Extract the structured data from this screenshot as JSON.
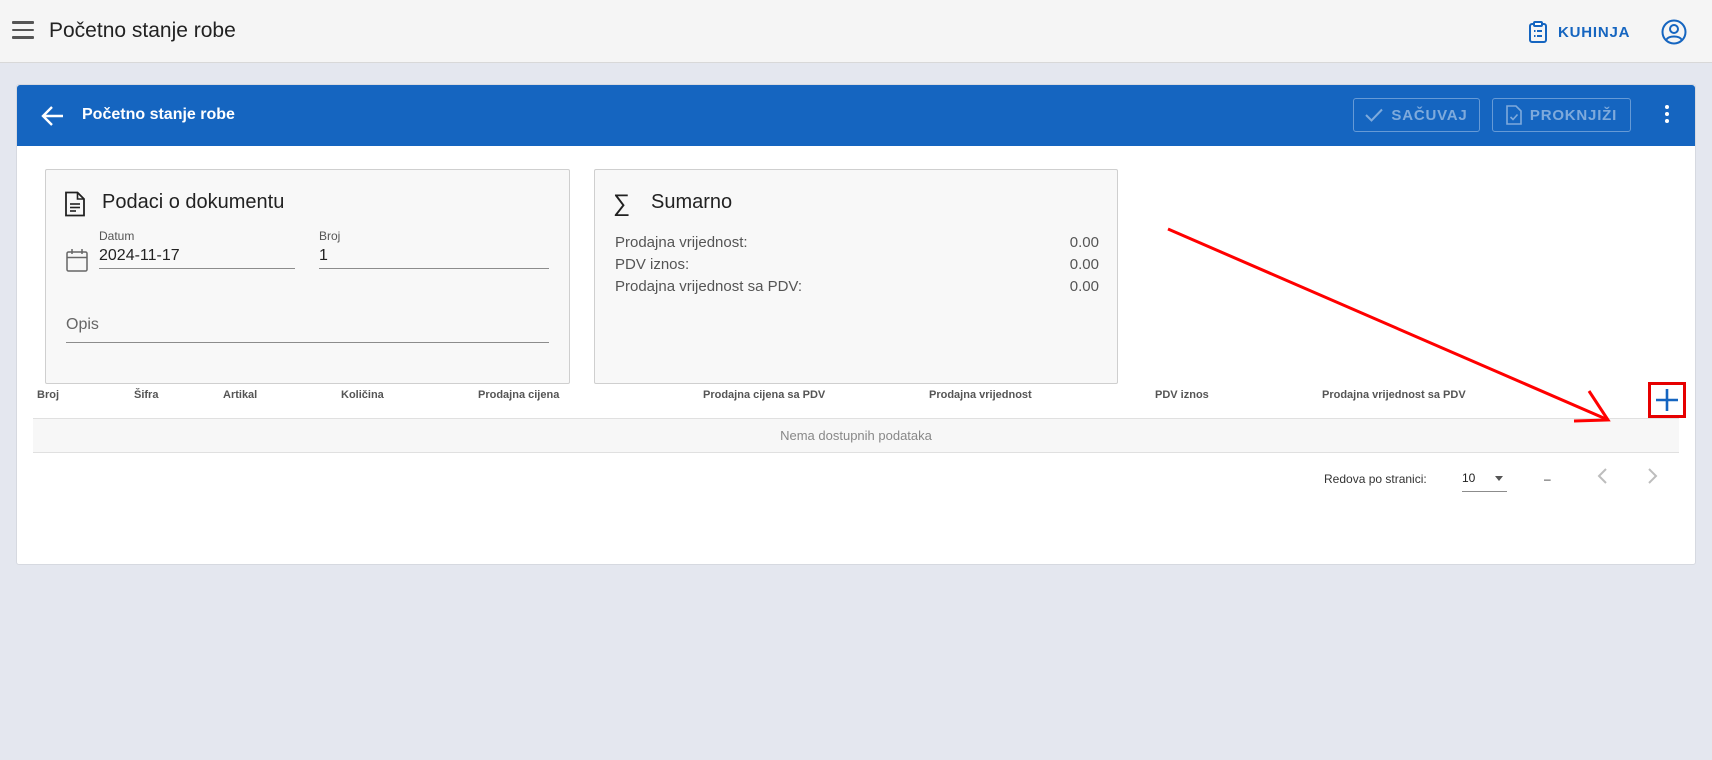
{
  "appbar": {
    "title": "Početno stanje robe",
    "location_label": "KUHINJA"
  },
  "card": {
    "title": "Početno stanje robe",
    "save_label": "SAČUVAJ",
    "post_label": "PROKNJIŽI"
  },
  "document_panel": {
    "title": "Podaci o dokumentu",
    "date_label": "Datum",
    "date_value": "2024-11-17",
    "number_label": "Broj",
    "number_value": "1",
    "description_label": "Opis"
  },
  "summary_panel": {
    "title": "Sumarno",
    "rows": [
      {
        "label": "Prodajna vrijednost:",
        "value": "0.00"
      },
      {
        "label": "PDV iznos:",
        "value": "0.00"
      },
      {
        "label": "Prodajna vrijednost sa PDV:",
        "value": "0.00"
      }
    ]
  },
  "table": {
    "columns": [
      "Broj",
      "Šifra",
      "Artikal",
      "Količina",
      "Prodajna cijena",
      "Prodajna cijena sa PDV",
      "Prodajna vrijednost",
      "PDV iznos",
      "Prodajna vrijednost sa PDV"
    ],
    "empty_text": "Nema dostupnih podataka"
  },
  "pagination": {
    "rows_per_page_label": "Redova po stranici:",
    "rows_per_page_value": "10",
    "range_text": "–"
  },
  "colors": {
    "primary": "#1565c0",
    "highlight": "#e60000"
  },
  "icons": [
    "menu-icon",
    "clipboard-icon",
    "account-icon",
    "arrow-left-icon",
    "check-icon",
    "document-check-icon",
    "more-vert-icon",
    "document-icon",
    "calendar-icon",
    "sigma-icon",
    "plus-icon",
    "chevron-left-icon",
    "chevron-right-icon"
  ]
}
